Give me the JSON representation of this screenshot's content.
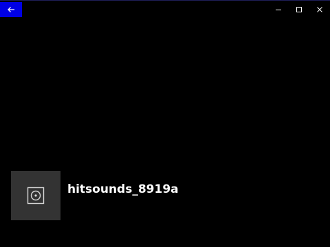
{
  "titlebar": {
    "back_icon": "arrow-left-icon",
    "accent_color": "#0000e6",
    "controls": [
      "minimize-icon",
      "maximize-icon",
      "close-icon"
    ]
  },
  "media": {
    "thumbnail_icon": "speaker-icon",
    "title": "hitsounds_8919a"
  }
}
